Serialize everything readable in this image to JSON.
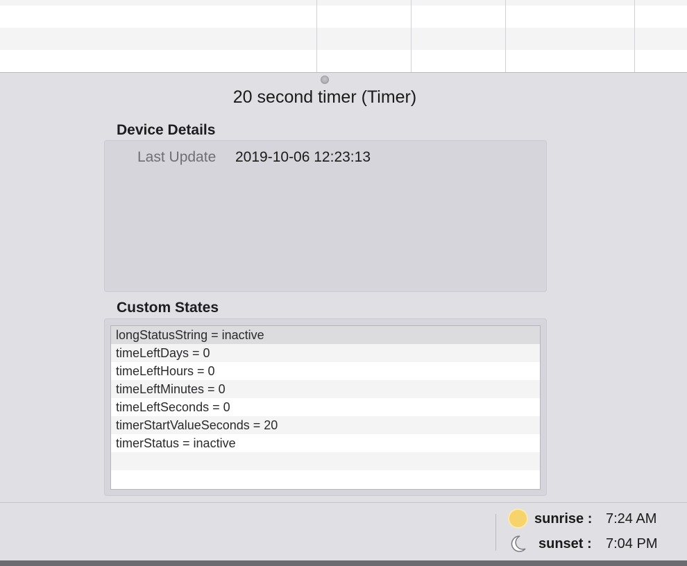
{
  "device": {
    "title": "20 second timer (Timer)"
  },
  "device_details": {
    "heading": "Device Details",
    "last_update_label": "Last Update",
    "last_update_value": "2019-10-06 12:23:13"
  },
  "custom_states": {
    "heading": "Custom States",
    "items": [
      "longStatusString = inactive",
      "timeLeftDays = 0",
      "timeLeftHours = 0",
      "timeLeftMinutes = 0",
      "timeLeftSeconds = 0",
      "timerStartValueSeconds = 20",
      "timerStatus = inactive"
    ]
  },
  "status_bar": {
    "sunrise_label": "sunrise :",
    "sunrise_time": "7:24 AM",
    "sunrise_icon": "sun-icon",
    "sunset_label": "sunset :",
    "sunset_time": "7:04 PM",
    "sunset_icon": "moon-icon"
  }
}
